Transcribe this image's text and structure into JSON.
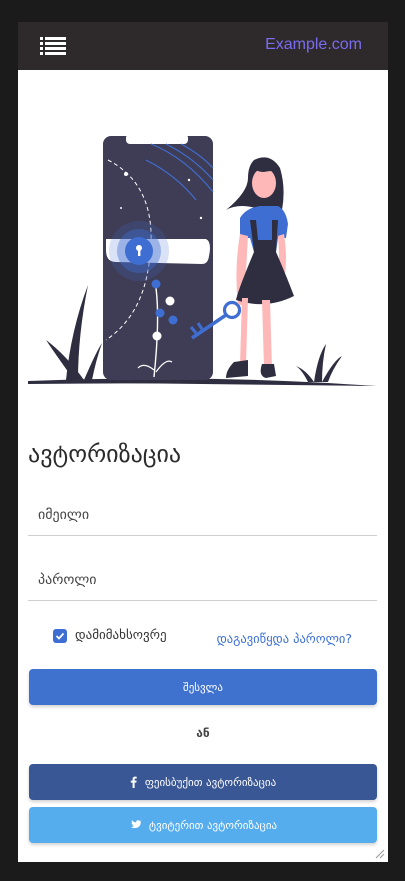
{
  "header": {
    "brand": "Example.com",
    "menu_icon": "list-icon"
  },
  "form": {
    "title": "ავტორიზაცია",
    "email_placeholder": "იმეილი",
    "password_placeholder": "პაროლი",
    "remember_label": "დამიმახსოვრე",
    "remember_checked": true,
    "forgot_link": "დაგავიწყდა პაროლი?",
    "login_button": "შესვლა",
    "or_text": "ან",
    "facebook_button": "ფეისბუქით ავტორიზაცია",
    "twitter_button": "ტვიტერით ავტორიზაცია"
  },
  "colors": {
    "topbar": "#2e2a2b",
    "brand": "#7a6cf0",
    "login": "#3f72cf",
    "facebook": "#3a5795",
    "twitter": "#55aded",
    "link": "#3a70d6"
  }
}
